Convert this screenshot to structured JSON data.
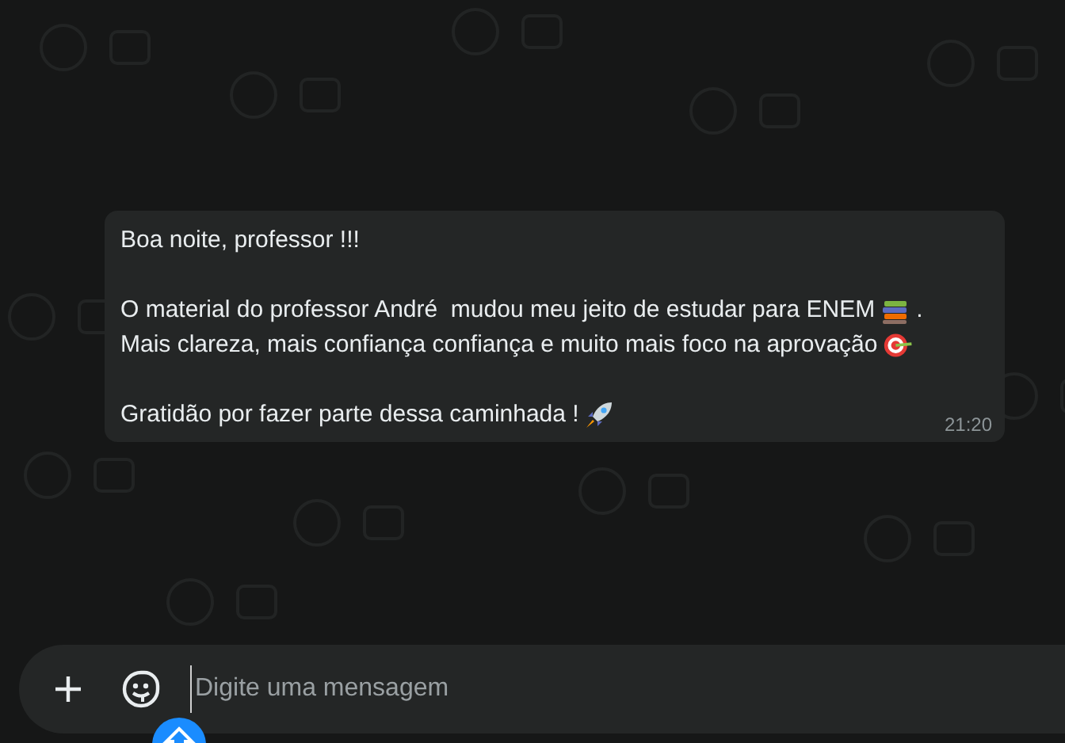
{
  "message": {
    "paragraphs": [
      [
        "Boa noite, professor !!!"
      ],
      [
        "O material do professor André  mudou meu jeito de estudar para ENEM",
        ".",
        "Mais clareza, mais confiança confiança e muito mais foco na aprovação"
      ],
      [
        "Gratidão por fazer parte dessa caminhada !"
      ]
    ],
    "time": "21:20"
  },
  "composer": {
    "placeholder": "Digite uma mensagem"
  }
}
